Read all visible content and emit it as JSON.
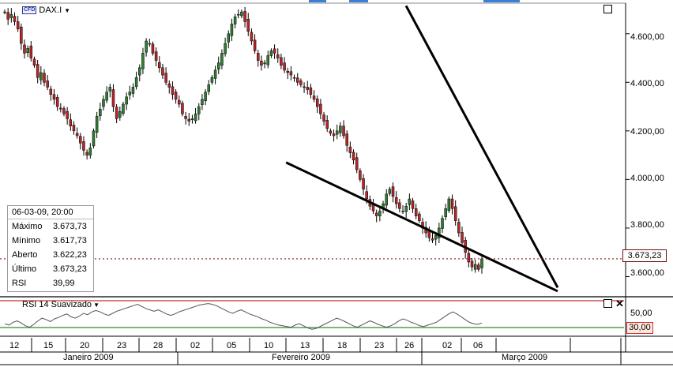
{
  "symbol": {
    "badge": "CFD",
    "name": "DAX.I"
  },
  "y_axis_labels": [
    "4.600,00",
    "4.400,00",
    "4.200,00",
    "4.000,00",
    "3.800,00",
    "3.600,00"
  ],
  "current_price_label": "3.673,23",
  "info": {
    "datetime": "06-03-09, 20:00",
    "rows": [
      {
        "key": "Máximo",
        "value": "3.673,73"
      },
      {
        "key": "Mínimo",
        "value": "3.617,73"
      },
      {
        "key": "Aberto",
        "value": "3.622,23"
      },
      {
        "key": "Último",
        "value": "3.673,23"
      },
      {
        "key": "RSI",
        "value": "39,99"
      }
    ]
  },
  "rsi_panel": {
    "label": "RSI 14 Suavizado",
    "axis_label": "50,00",
    "level_tag": "30,00"
  },
  "x_day_labels": [
    "12",
    "15",
    "20",
    "23",
    "28",
    "02",
    "05",
    "10",
    "13",
    "18",
    "23",
    "26",
    "02",
    "06"
  ],
  "x_month_labels": [
    "Janeiro 2009",
    "Fevereiro 2009",
    "Março 2009"
  ],
  "colors": {
    "up_candle": "#2f7d32",
    "down_candle": "#b8262a",
    "wick": "#000000",
    "trendline": "#000000",
    "price_line": "#8b1a1a",
    "rsi_upper": "#c0302f",
    "rsi_lower": "#2e8b2e",
    "rsi_line": "#555555",
    "toolbar_accent": "#3a7fd6"
  },
  "icons": {
    "window_restore": "square-icon",
    "close": "close-icon",
    "dropdown": "caret-down-icon"
  },
  "chart_data": {
    "type": "candlestick",
    "price_range": [
      3517,
      4726
    ],
    "current_price": 3673.23,
    "closes": [
      4690,
      4660,
      4680,
      4650,
      4620,
      4560,
      4520,
      4540,
      4500,
      4470,
      4420,
      4440,
      4400,
      4380,
      4350,
      4330,
      4300,
      4290,
      4270,
      4250,
      4220,
      4200,
      4180,
      4150,
      4120,
      4100,
      4130,
      4200,
      4260,
      4290,
      4330,
      4360,
      4380,
      4300,
      4250,
      4280,
      4310,
      4340,
      4360,
      4380,
      4420,
      4460,
      4520,
      4570,
      4560,
      4520,
      4490,
      4460,
      4430,
      4400,
      4380,
      4350,
      4330,
      4310,
      4270,
      4250,
      4240,
      4250,
      4270,
      4300,
      4330,
      4360,
      4390,
      4420,
      4450,
      4480,
      4520,
      4560,
      4600,
      4640,
      4670,
      4680,
      4690,
      4650,
      4610,
      4570,
      4530,
      4490,
      4470,
      4480,
      4510,
      4530,
      4520,
      4500,
      4470,
      4450,
      4440,
      4430,
      4420,
      4400,
      4390,
      4380,
      4370,
      4350,
      4330,
      4300,
      4270,
      4240,
      4210,
      4190,
      4180,
      4200,
      4220,
      4180,
      4140,
      4110,
      4080,
      4040,
      4000,
      3960,
      3920,
      3890,
      3870,
      3850,
      3870,
      3900,
      3940,
      3960,
      3930,
      3900,
      3880,
      3870,
      3890,
      3920,
      3880,
      3850,
      3830,
      3800,
      3780,
      3760,
      3750,
      3770,
      3800,
      3840,
      3880,
      3920,
      3880,
      3830,
      3780,
      3740,
      3700,
      3660,
      3640,
      3650,
      3630,
      3673
    ],
    "trendlines": [
      {
        "from": [
          90,
          4715
        ],
        "to": [
          235,
          3555
        ]
      },
      {
        "from": [
          39,
          4070
        ],
        "to": [
          235,
          3540
        ]
      }
    ],
    "rsi": {
      "levels": [
        70,
        30
      ],
      "values": [
        38,
        36,
        40,
        42,
        39,
        35,
        33,
        37,
        42,
        46,
        44,
        41,
        45,
        47,
        50,
        52,
        48,
        46,
        49,
        53,
        51,
        55,
        57,
        55,
        52,
        50,
        53,
        56,
        58,
        60,
        62,
        64,
        66,
        63,
        60,
        58,
        56,
        58,
        55,
        52,
        50,
        52,
        55,
        57,
        59,
        61,
        63,
        65,
        66,
        67,
        66,
        64,
        61,
        58,
        55,
        53,
        56,
        58,
        55,
        52,
        50,
        48,
        45,
        43,
        40,
        38,
        36,
        35,
        34,
        33,
        36,
        38,
        35,
        32,
        30,
        31,
        34,
        37,
        40,
        43,
        46,
        44,
        41,
        38,
        35,
        33,
        36,
        39,
        42,
        40,
        37,
        35,
        33,
        35,
        38,
        42,
        45,
        43,
        40,
        38,
        35,
        34,
        36,
        38,
        40,
        44,
        48,
        52,
        55,
        52,
        48,
        44,
        40,
        38,
        37,
        39
      ]
    }
  }
}
